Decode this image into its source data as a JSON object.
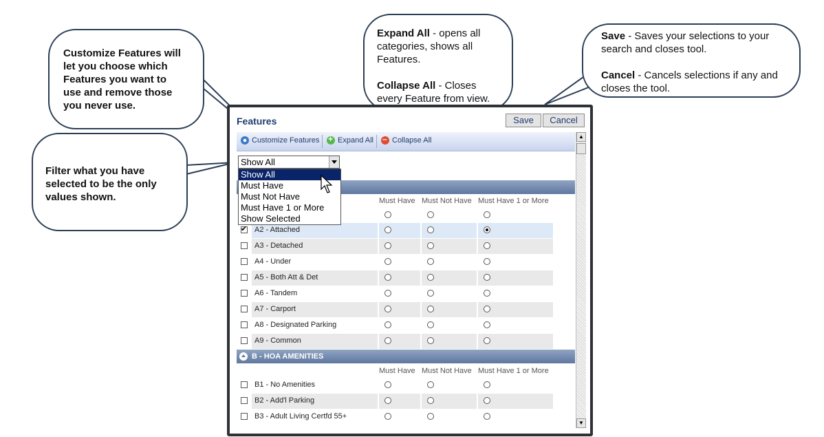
{
  "callouts": {
    "customize": {
      "lines": [
        "Customize Features will",
        "let you choose which",
        "Features you want to",
        "use and remove those",
        "you never use."
      ]
    },
    "filter": {
      "lines": [
        "Filter what you have",
        "selected  to be the only",
        "values shown."
      ]
    },
    "expand": {
      "expand_term": "Expand All",
      "expand_text": " - opens all categories, shows all Features.",
      "collapse_term": "Collapse All",
      "collapse_text": " - Closes every Feature from view."
    },
    "save": {
      "save_term": "Save",
      "save_text": " - Saves your selections to your search and closes tool.",
      "cancel_term": "Cancel",
      "cancel_text": " - Cancels selections if any and closes the tool."
    }
  },
  "dialog": {
    "title": "Features",
    "save_label": "Save",
    "cancel_label": "Cancel",
    "toolbar": {
      "customize_label": "Customize Features",
      "expand_label": "Expand All",
      "collapse_label": "Collapse All"
    },
    "filter": {
      "selected": "Show All",
      "options": [
        "Show All",
        "Must Have",
        "Must Not Have",
        "Must Have 1 or More",
        "Show Selected"
      ]
    },
    "columns": [
      "Must Have",
      "Must Not Have",
      "Must Have 1 or More"
    ],
    "category_b": {
      "label": "B - HOA AMENITIES"
    },
    "rows_a": [
      {
        "label": "A2 - Attached",
        "checked": true,
        "choice": 3
      },
      {
        "label": "A3 - Detached",
        "checked": false,
        "choice": 0
      },
      {
        "label": "A4 - Under",
        "checked": false,
        "choice": 0
      },
      {
        "label": "A5 - Both Att & Det",
        "checked": false,
        "choice": 0
      },
      {
        "label": "A6 - Tandem",
        "checked": false,
        "choice": 0
      },
      {
        "label": "A7 - Carport",
        "checked": false,
        "choice": 0
      },
      {
        "label": "A8 - Designated Parking",
        "checked": false,
        "choice": 0
      },
      {
        "label": "A9 - Common",
        "checked": false,
        "choice": 0
      }
    ],
    "rows_b": [
      {
        "label": "B1 - No Amenities",
        "checked": false,
        "choice": 0
      },
      {
        "label": "B2 - Add'l Parking",
        "checked": false,
        "choice": 0
      },
      {
        "label": "B3 - Adult Living Certfd 55+",
        "checked": false,
        "choice": 0
      }
    ]
  }
}
